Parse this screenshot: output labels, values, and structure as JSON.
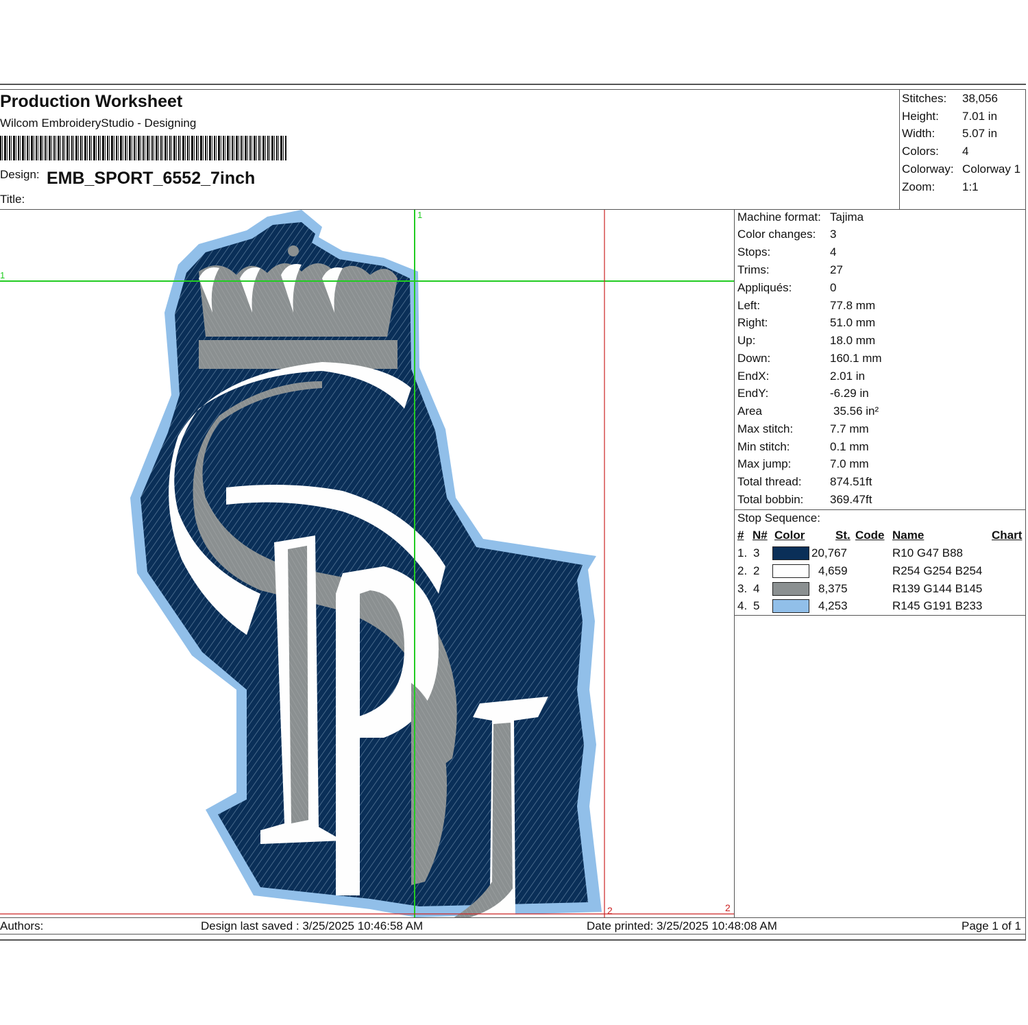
{
  "header": {
    "title": "Production Worksheet",
    "software": "Wilcom EmbroideryStudio - Designing",
    "design_label": "Design:",
    "design_name": "EMB_SPORT_6552_7inch",
    "title_label": "Title:"
  },
  "summary": [
    {
      "label": "Stitches:",
      "value": "38,056"
    },
    {
      "label": "Height:",
      "value": "7.01 in"
    },
    {
      "label": "Width:",
      "value": "5.07 in"
    },
    {
      "label": "Colors:",
      "value": "4"
    },
    {
      "label": "Colorway:",
      "value": "Colorway 1"
    },
    {
      "label": "Zoom:",
      "value": "1:1"
    }
  ],
  "machine": [
    {
      "label": "Machine format:",
      "value": "Tajima"
    },
    {
      "label": "Color changes:",
      "value": "3"
    },
    {
      "label": "Stops:",
      "value": "4"
    },
    {
      "label": "Trims:",
      "value": "27"
    },
    {
      "label": "Appliqués:",
      "value": "0"
    },
    {
      "label": "Left:",
      "value": "77.8 mm"
    },
    {
      "label": "Right:",
      "value": "51.0 mm"
    },
    {
      "label": "Up:",
      "value": "18.0 mm"
    },
    {
      "label": "Down:",
      "value": "160.1 mm"
    },
    {
      "label": "EndX:",
      "value": "2.01 in"
    },
    {
      "label": "EndY:",
      "value": "-6.29 in"
    },
    {
      "label": "Area",
      "value": "35.56 in²"
    },
    {
      "label": "Max stitch:",
      "value": "7.7 mm"
    },
    {
      "label": "Min stitch:",
      "value": "0.1 mm"
    },
    {
      "label": "Max jump:",
      "value": "7.0 mm"
    },
    {
      "label": "Total thread:",
      "value": "874.51ft"
    },
    {
      "label": "Total bobbin:",
      "value": "369.47ft"
    }
  ],
  "stop_sequence": {
    "title": "Stop Sequence:",
    "headers": {
      "num": "#",
      "n": "N#",
      "color": "Color",
      "st": "St.",
      "code": "Code",
      "name": "Name",
      "chart": "Chart"
    },
    "rows": [
      {
        "num": "1.",
        "n": "3",
        "color": "#0a2f58",
        "st": "20,767",
        "name": "R10 G47 B88"
      },
      {
        "num": "2.",
        "n": "2",
        "color": "#fefefe",
        "st": "4,659",
        "name": "R254 G254 B254"
      },
      {
        "num": "3.",
        "n": "4",
        "color": "#8b9091",
        "st": "8,375",
        "name": "R139 G144 B145"
      },
      {
        "num": "4.",
        "n": "5",
        "color": "#91bfe9",
        "st": "4,253",
        "name": "R145 G191 B233"
      }
    ]
  },
  "guides": {
    "green_label_top": "1",
    "green_label_left": "1",
    "red_label_a": "2",
    "red_label_b": "2"
  },
  "footer": {
    "authors": "Authors:",
    "saved": "Design last saved : 3/25/2025 10:46:58 AM",
    "printed": "Date printed: 3/25/2025 10:48:08 AM",
    "page": "Page 1 of 1"
  },
  "colors": {
    "navy": "#0a2f58",
    "white": "#fefefe",
    "gray": "#8b9091",
    "light_blue": "#91bfe9"
  }
}
